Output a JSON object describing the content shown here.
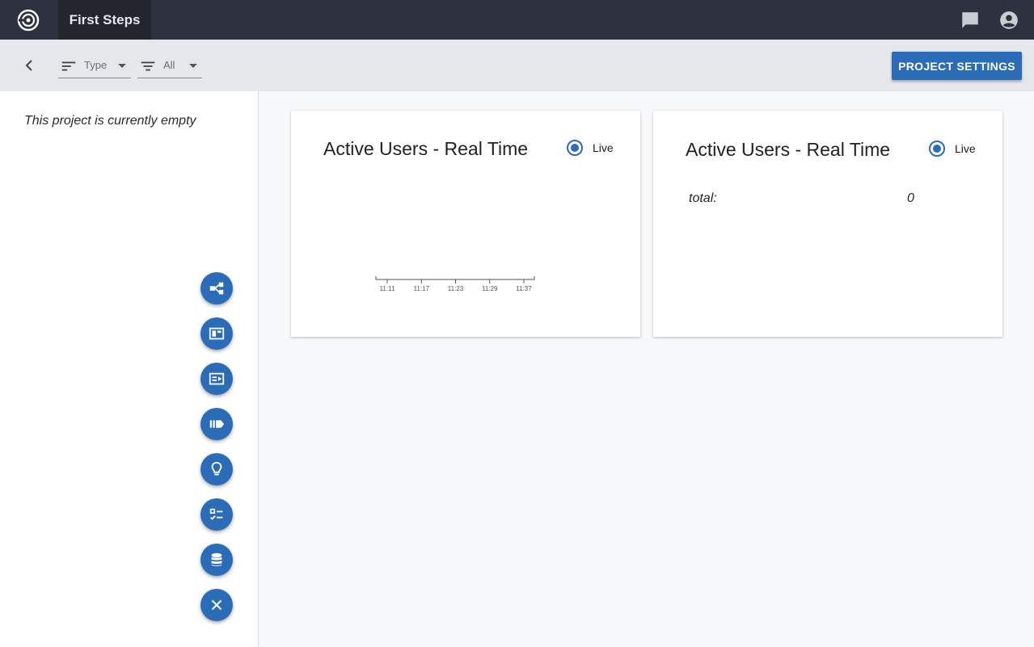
{
  "topbar": {
    "project_name": "First Steps",
    "icons": [
      "logo-icon",
      "chat-icon",
      "account-icon"
    ]
  },
  "toolbar": {
    "sort_label": "Type",
    "filter_label": "All",
    "settings_label": "PROJECT SETTINGS"
  },
  "sidebar": {
    "empty_message": "This project is currently empty",
    "fab_icons": [
      "flow-icon",
      "dashboard-icon",
      "presentation-icon",
      "pipeline-icon",
      "lightbulb-icon",
      "checklist-icon",
      "database-icon",
      "close-icon"
    ]
  },
  "cards": [
    {
      "title": "Active Users - Real Time",
      "live_label": "Live",
      "chart_data": {
        "type": "line",
        "x": [
          "11:11",
          "11:17",
          "11:23",
          "11:29",
          "11:37"
        ],
        "series": []
      }
    },
    {
      "title": "Active Users - Real Time",
      "live_label": "Live",
      "stat_label": "total:",
      "stat_value": "0"
    }
  ],
  "colors": {
    "topbar": "#2d3140",
    "accent": "#2b6cb8",
    "toolbar": "#e6e7ea"
  }
}
